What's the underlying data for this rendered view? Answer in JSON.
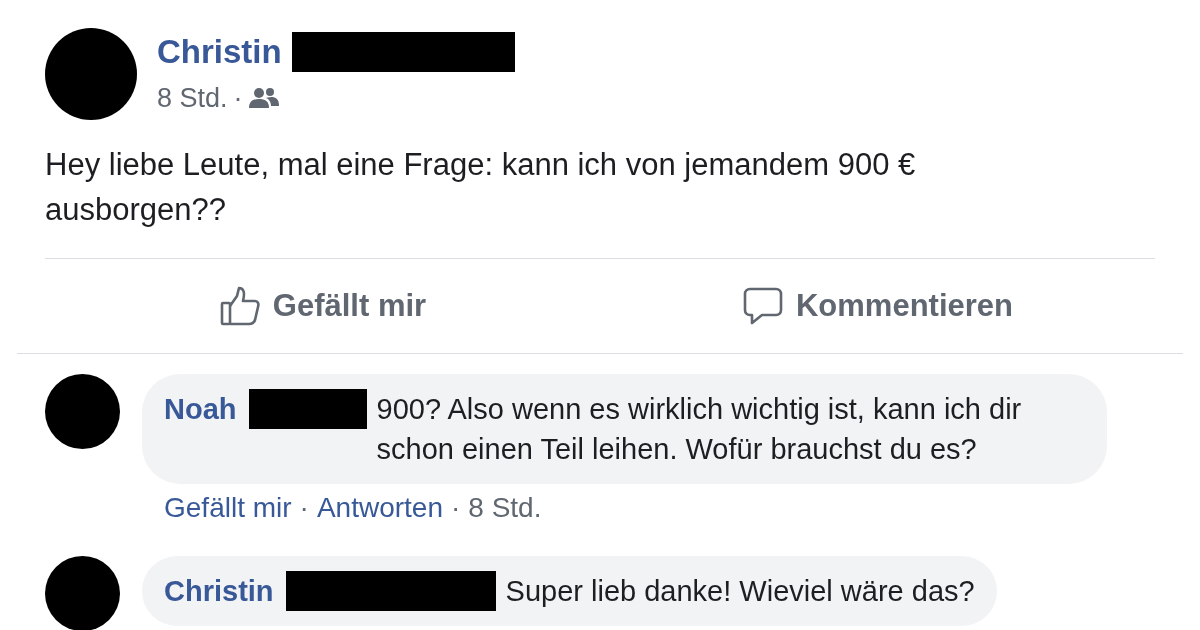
{
  "post": {
    "author": "Christin",
    "surname_redacted": true,
    "time": "8 Std.",
    "separator": "·",
    "body": "Hey liebe Leute, mal eine Frage: kann ich von jemandem 900 € ausborgen??",
    "actions": [
      {
        "kind": "like",
        "label": "Gefällt mir"
      },
      {
        "kind": "comment",
        "label": "Kommentieren"
      }
    ]
  },
  "comments": [
    {
      "author": "Noah",
      "surname_redacted": true,
      "text": "900? Also wenn es wirklich wichtig ist, kann ich dir schon einen Teil leihen. Wofür brauchst du es?",
      "meta": [
        {
          "kind": "link",
          "text": "Gefällt mir"
        },
        {
          "kind": "link",
          "text": "Antworten"
        },
        {
          "kind": "time",
          "text": "8 Std."
        }
      ]
    },
    {
      "author": "Christin",
      "surname_redacted": true,
      "text": "Super lieb danke! Wieviel wäre das?"
    }
  ]
}
